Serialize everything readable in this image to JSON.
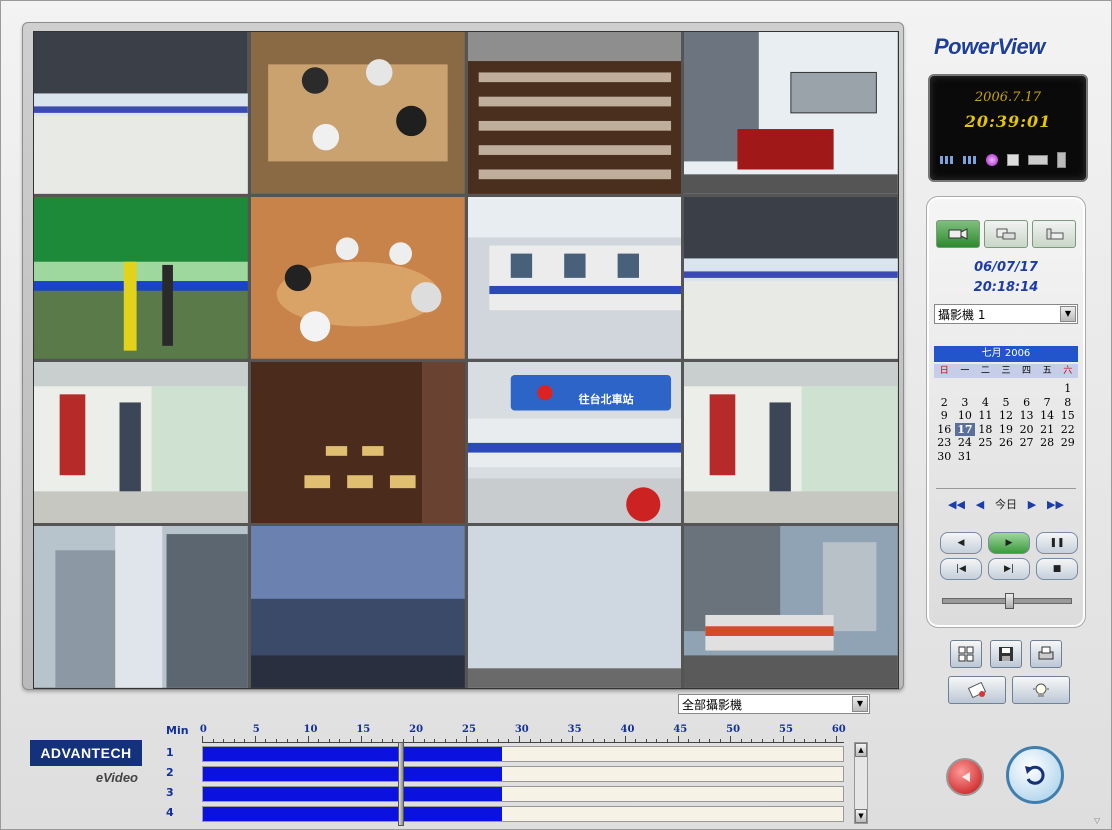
{
  "brand": "PowerView",
  "clock": {
    "date": "2006.7.17",
    "time": "20:39:01"
  },
  "cameras": [
    {
      "id": 1,
      "scene": "station-platform"
    },
    {
      "id": 2,
      "scene": "meeting-room"
    },
    {
      "id": 3,
      "scene": "crowd-hall"
    },
    {
      "id": 4,
      "scene": "container-port"
    },
    {
      "id": 5,
      "scene": "subway-train-green"
    },
    {
      "id": 6,
      "scene": "round-table-meeting"
    },
    {
      "id": 7,
      "scene": "train-platform"
    },
    {
      "id": 8,
      "scene": "station-platform"
    },
    {
      "id": 9,
      "scene": "platform-passengers"
    },
    {
      "id": 10,
      "scene": "corridor"
    },
    {
      "id": 11,
      "scene": "station-sign"
    },
    {
      "id": 12,
      "scene": "platform-passengers"
    },
    {
      "id": 13,
      "scene": "skyscrapers"
    },
    {
      "id": 14,
      "scene": "modern-building"
    },
    {
      "id": 15,
      "scene": "glass-dome"
    },
    {
      "id": 16,
      "scene": "express-train"
    }
  ],
  "station_sign": "往台北車站",
  "playback": {
    "date": "06/07/17",
    "time": "20:18:14",
    "camera_select": "攝影機 1",
    "calendar": {
      "month_title": "七月 2006",
      "weekdays": [
        "日",
        "一",
        "二",
        "三",
        "四",
        "五",
        "六"
      ],
      "days": [
        "",
        "",
        "",
        "",
        "",
        "",
        "1",
        "2",
        "3",
        "4",
        "5",
        "6",
        "7",
        "8",
        "9",
        "10",
        "11",
        "12",
        "13",
        "14",
        "15",
        "16",
        "17",
        "18",
        "19",
        "20",
        "21",
        "22",
        "23",
        "24",
        "25",
        "26",
        "27",
        "28",
        "29",
        "30",
        "31"
      ],
      "selected_day": "17",
      "today_label": "今日"
    },
    "slider_value": 0.52
  },
  "timeline": {
    "camera_filter": "全部攝影機",
    "min_label": "Min",
    "scale": [
      "0",
      "5",
      "10",
      "15",
      "20",
      "25",
      "30",
      "35",
      "40",
      "45",
      "50",
      "55",
      "60"
    ],
    "rows": [
      {
        "label": "1",
        "recorded_start": 0,
        "recorded_end": 28
      },
      {
        "label": "2",
        "recorded_start": 0,
        "recorded_end": 28
      },
      {
        "label": "3",
        "recorded_start": 0,
        "recorded_end": 28
      },
      {
        "label": "4",
        "recorded_start": 0,
        "recorded_end": 28
      }
    ],
    "cursor_minute": 18.3
  },
  "logo": {
    "company": "ADVANTECH",
    "product": "eVideo"
  },
  "colors": {
    "brand_blue": "#1d3e9b",
    "record_blue": "#0b12e0",
    "lcd_gold": "#e7c600"
  }
}
